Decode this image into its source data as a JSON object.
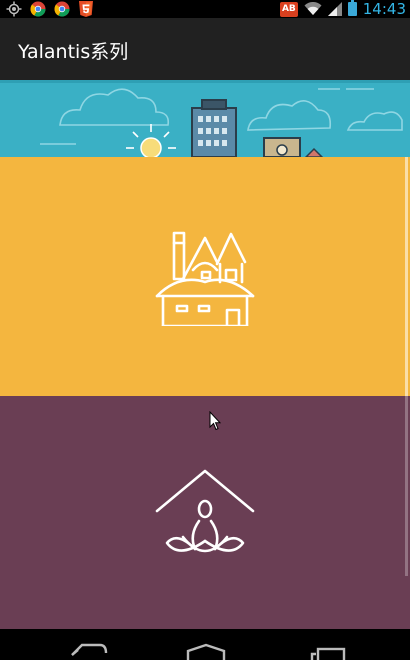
{
  "status_bar": {
    "notification_icons": [
      "location-icon",
      "chrome-icon",
      "chrome-icon",
      "html5-icon"
    ],
    "ab_badge": "AB",
    "time": "14:43"
  },
  "action_bar": {
    "title": "Yalantis系列"
  },
  "list": {
    "items": [
      {
        "icon": "city-skyline-icon",
        "color": "#3ab0c5"
      },
      {
        "icon": "house-icon",
        "color": "#f4b63f"
      },
      {
        "icon": "meditation-house-icon",
        "color": "#6a3e54"
      }
    ]
  },
  "nav_bar": {
    "buttons": [
      "back-button",
      "home-button",
      "recents-button"
    ]
  }
}
